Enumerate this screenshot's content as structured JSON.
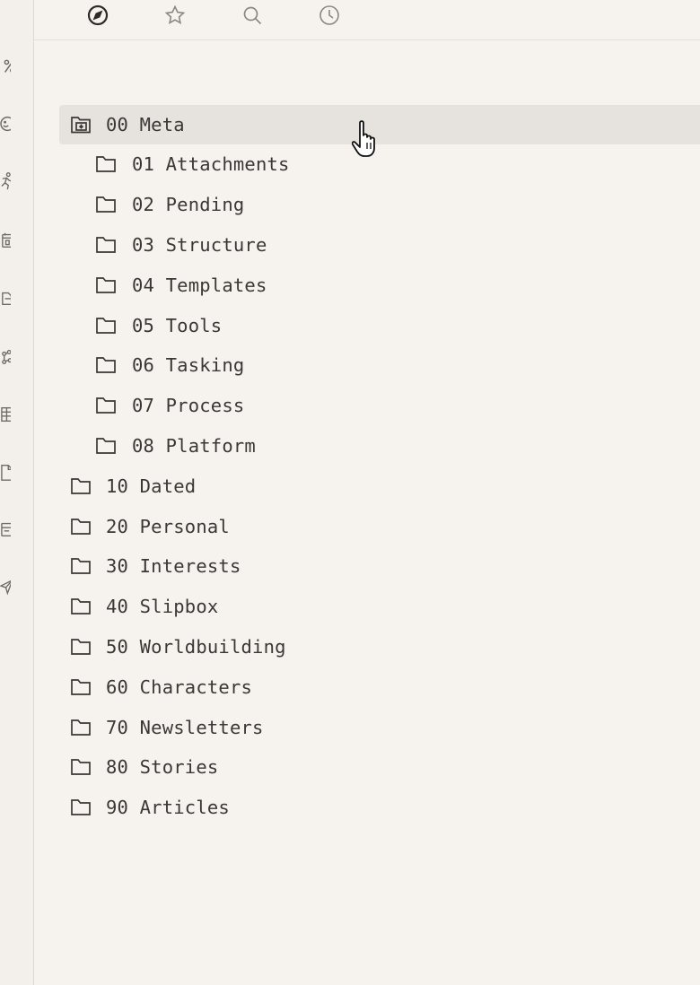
{
  "ribbon": {
    "icons": [
      "percent-icon",
      "smiley-icon",
      "runner-icon",
      "calendar-icon",
      "export-icon",
      "graph-icon",
      "table-icon",
      "file-icon",
      "window-icon",
      "send-icon"
    ]
  },
  "topbar": {
    "tabs": [
      {
        "name": "explore",
        "icon": "compass-icon",
        "active": true
      },
      {
        "name": "bookmarks",
        "icon": "star-icon",
        "active": false
      },
      {
        "name": "search",
        "icon": "search-icon",
        "active": false
      },
      {
        "name": "recent",
        "icon": "clock-icon",
        "active": false
      }
    ]
  },
  "tree": {
    "selected": {
      "label": "00 Meta",
      "icon": "folder-open-icon"
    },
    "children": [
      {
        "label": "01 Attachments"
      },
      {
        "label": "02 Pending"
      },
      {
        "label": "03 Structure"
      },
      {
        "label": "04 Templates"
      },
      {
        "label": "05 Tools"
      },
      {
        "label": "06 Tasking"
      },
      {
        "label": "07 Process"
      },
      {
        "label": "08 Platform"
      }
    ],
    "top_level": [
      {
        "label": "10 Dated"
      },
      {
        "label": "20 Personal"
      },
      {
        "label": "30 Interests"
      },
      {
        "label": "40 Slipbox"
      },
      {
        "label": "50 Worldbuilding"
      },
      {
        "label": "60 Characters"
      },
      {
        "label": "70 Newsletters"
      },
      {
        "label": "80 Stories"
      },
      {
        "label": "90 Articles"
      }
    ]
  }
}
